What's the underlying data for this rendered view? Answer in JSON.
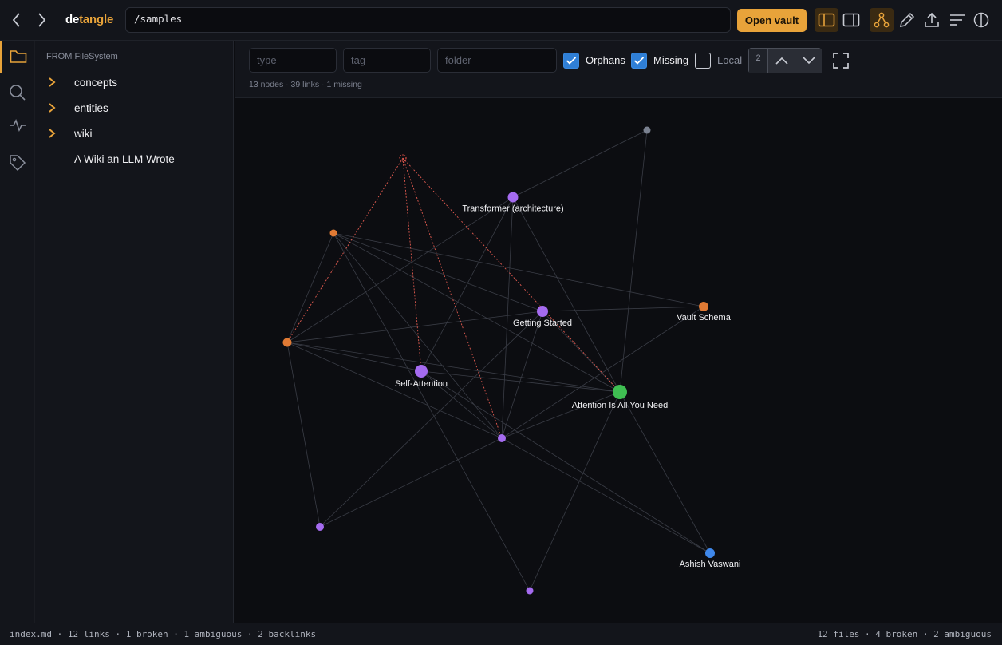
{
  "app": {
    "brand_part1": "de",
    "brand_part2": "tangle",
    "path": "/samples",
    "open_vault_label": "Open vault",
    "accent_color": "#e8a33a"
  },
  "toolbar": {
    "icons": [
      "layout-left-icon",
      "layout-right-icon",
      "graph-icon",
      "pencil-icon",
      "upload-icon",
      "outline-icon",
      "info-icon"
    ]
  },
  "rail": {
    "items": [
      "folder-icon",
      "search-icon",
      "activity-icon",
      "tag-icon"
    ]
  },
  "sidebar": {
    "header": "FROM FileSystem",
    "items": [
      {
        "label": "concepts",
        "expandable": true
      },
      {
        "label": "entities",
        "expandable": true
      },
      {
        "label": "wiki",
        "expandable": true
      },
      {
        "label": "A Wiki an LLM Wrote",
        "expandable": false
      }
    ]
  },
  "filters": {
    "type_placeholder": "type",
    "tag_placeholder": "tag",
    "folder_placeholder": "folder",
    "orphans_label": "Orphans",
    "orphans_checked": true,
    "missing_label": "Missing",
    "missing_checked": true,
    "local_label": "Local",
    "local_checked": false,
    "depth_value": "2"
  },
  "graph": {
    "stats": "13 nodes · 39 links · 1 missing",
    "colors": {
      "concept": "#a56bf0",
      "entity": "#e07a34",
      "paper": "#3fbf52",
      "person": "#3f87ea",
      "missing": "#ff5b4f",
      "unknown": "#7a8190",
      "edge": "#3a3d46",
      "missing_edge": "#e25b50"
    },
    "labels": {
      "transformer": "Transformer (architecture)",
      "getting_started": "Getting Started",
      "vault_schema": "Vault Schema",
      "self_attention": "Self-Attention",
      "attention": "Attention Is All You Need",
      "ashish": "Ashish Vaswani"
    }
  },
  "status": {
    "left": "index.md · 12 links · 1 broken · 1 ambiguous · 2 backlinks",
    "right": "12 files · 4 broken · 2 ambiguous"
  }
}
